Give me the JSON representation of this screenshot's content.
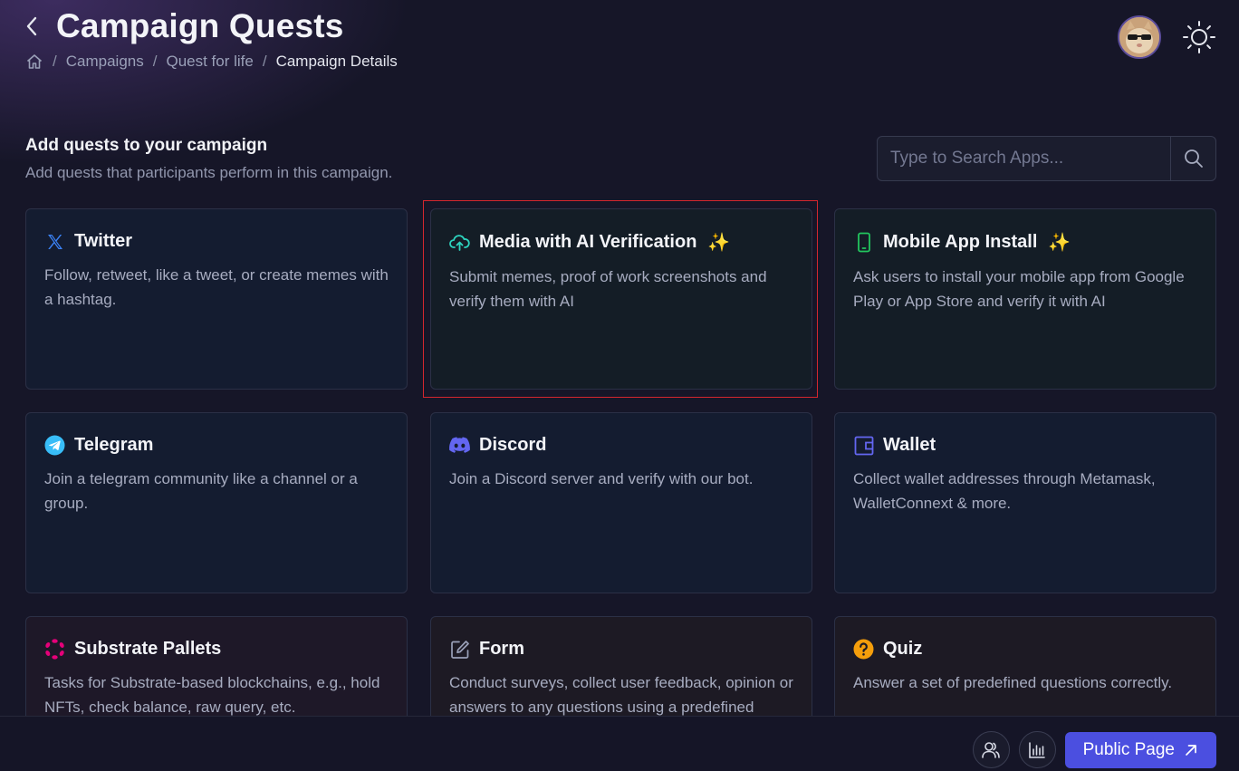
{
  "header": {
    "title": "Campaign Quests",
    "breadcrumb": [
      "Campaigns",
      "Quest for life",
      "Campaign Details"
    ]
  },
  "section": {
    "title": "Add quests to your campaign",
    "subtitle": "Add quests that participants perform in this campaign."
  },
  "search": {
    "placeholder": "Type to Search Apps..."
  },
  "cards": [
    {
      "title": "Twitter",
      "desc": "Follow, retweet, like a tweet, or create memes with a hashtag.",
      "icon": "x-logo-icon"
    },
    {
      "title": "Media with AI Verification",
      "desc": "Submit memes, proof of work screenshots and verify them with AI",
      "icon": "cloud-upload-icon",
      "sparkle": "✨"
    },
    {
      "title": "Mobile App Install",
      "desc": "Ask users to install your mobile app from Google Play or App Store and verify it with AI",
      "icon": "mobile-phone-icon",
      "sparkle": "✨"
    },
    {
      "title": "Telegram",
      "desc": "Join a telegram community like a channel or a group.",
      "icon": "telegram-icon"
    },
    {
      "title": "Discord",
      "desc": "Join a Discord server and verify with our bot.",
      "icon": "discord-icon"
    },
    {
      "title": "Wallet",
      "desc": "Collect wallet addresses through Metamask, WalletConnext & more.",
      "icon": "wallet-icon"
    },
    {
      "title": "Substrate Pallets",
      "desc": "Tasks for Substrate-based blockchains, e.g., hold NFTs, check balance, raw query, etc.",
      "icon": "polkadot-icon"
    },
    {
      "title": "Form",
      "desc": "Conduct surveys, collect user feedback, opinion or answers to any questions using a predefined",
      "icon": "edit-form-icon"
    },
    {
      "title": "Quiz",
      "desc": "Answer a set of predefined questions correctly.",
      "icon": "question-circle-icon"
    }
  ],
  "footer": {
    "public_page_label": "Public Page"
  },
  "colors": {
    "accent": "#4b4fe0",
    "highlight": "#d4262e",
    "twitter": "#3b82f6",
    "media": "#2dd4bf",
    "mobile": "#22c55e",
    "telegram": "#38bdf8",
    "discord": "#6366f1",
    "wallet": "#6366f1",
    "substrate": "#e6007a",
    "quiz": "#f59e0b"
  }
}
